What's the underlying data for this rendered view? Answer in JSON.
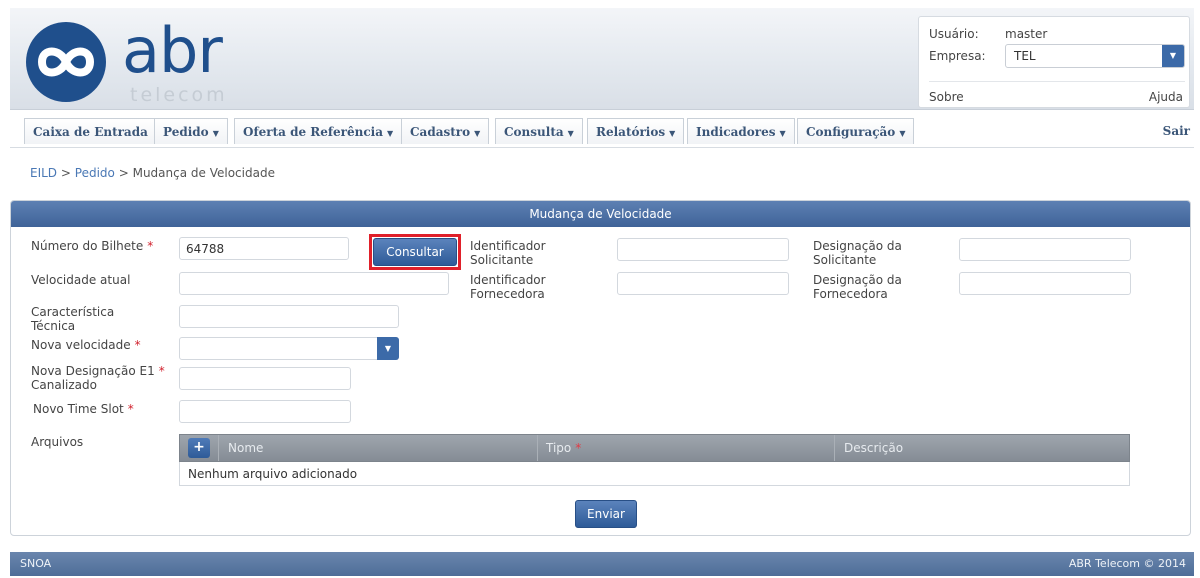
{
  "header": {
    "logo_text": "abr",
    "logo_subtext": "telecom",
    "user_label": "Usuário:",
    "user_value": "master",
    "company_label": "Empresa:",
    "company_value": "TEL",
    "about": "Sobre",
    "help": "Ajuda"
  },
  "nav": {
    "items": [
      {
        "label": "Caixa de Entrada"
      },
      {
        "label": "Pedido"
      },
      {
        "label": "Oferta de Referência"
      },
      {
        "label": "Cadastro"
      },
      {
        "label": "Consulta"
      },
      {
        "label": "Relatórios"
      },
      {
        "label": "Indicadores"
      },
      {
        "label": "Configuração"
      }
    ],
    "logout": "Sair"
  },
  "breadcrumb": {
    "root": "EILD",
    "sep1": ">",
    "middle": "Pedido",
    "sep2": ">",
    "current": "Mudança de Velocidade"
  },
  "form": {
    "title": "Mudança de Velocidade",
    "ticket_label": "Número do Bilhete",
    "ticket_value": "64788",
    "consult_button": "Consultar",
    "req_mark": "*",
    "requester_id_label_1": "Identificador",
    "requester_id_label_2": "Solicitante",
    "requester_desig_label_1": "Designação da",
    "requester_desig_label_2": "Solicitante",
    "current_speed_label": "Velocidade atual",
    "supplier_id_label_1": "Identificador",
    "supplier_id_label_2": "Fornecedora",
    "supplier_desig_label_1": "Designação da",
    "supplier_desig_label_2": "Fornecedora",
    "tech_char_label_1": "Característica",
    "tech_char_label_2": "Técnica",
    "new_speed_label": "Nova velocidade",
    "new_desig_label_1": "Nova Designação E1",
    "new_desig_label_2": "Canalizado",
    "new_timeslot_label": "Novo Time Slot",
    "files_label": "Arquivos",
    "files_add": "+",
    "files_col_name": "Nome",
    "files_col_type": "Tipo",
    "files_col_desc": "Descrição",
    "files_empty": "Nenhum arquivo adicionado",
    "submit_button": "Enviar"
  },
  "footer": {
    "left": "SNOA",
    "right": "ABR Telecom © 2014"
  }
}
